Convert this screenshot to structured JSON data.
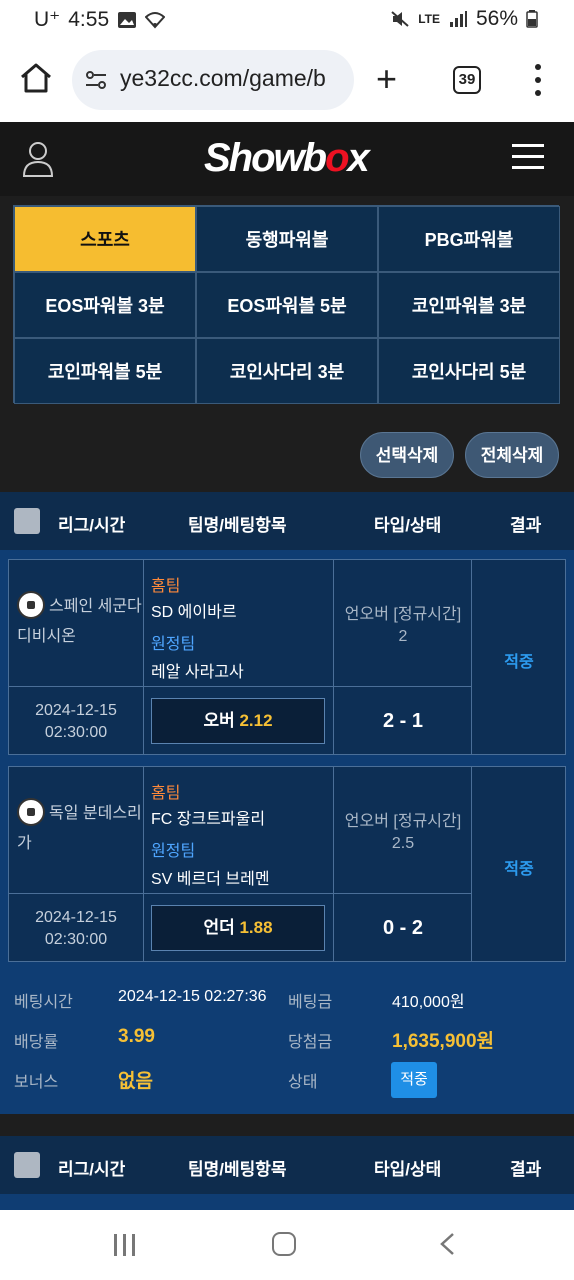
{
  "status": {
    "carrier": "U⁺",
    "time": "4:55",
    "net": "LTE",
    "battery": "56%"
  },
  "browser": {
    "url": "ye32cc.com/game/b",
    "tab_count": "39"
  },
  "site": {
    "logo_pre": "Showb",
    "logo_o": "o",
    "logo_post": "x"
  },
  "games": [
    "스포츠",
    "동행파워볼",
    "PBG파워볼",
    "EOS파워볼 3분",
    "EOS파워볼 5분",
    "코인파워볼 3분",
    "코인파워볼 5분",
    "코인사다리 3분",
    "코인사다리 5분"
  ],
  "actions": {
    "delete_selected": "선택삭제",
    "delete_all": "전체삭제"
  },
  "table_headers": {
    "league_time": "리그/시간",
    "team_item": "팀명/베팅항목",
    "type_status": "타입/상태",
    "result": "결과"
  },
  "bet1": {
    "matches": [
      {
        "league": "스페인 세군다 디비시온",
        "home_label": "홈팀",
        "home": "SD 에이바르",
        "away_label": "원정팀",
        "away": "레알 사라고사",
        "bet_type": "언오버 [정규시간]",
        "line": "2",
        "result": "적중",
        "date": "2024-12-15",
        "time": "02:30:00",
        "pick": "오버",
        "odds": "2.12",
        "score": "2 - 1"
      },
      {
        "league": "독일 분데스리가",
        "home_label": "홈팀",
        "home": "FC 장크트파울리",
        "away_label": "원정팀",
        "away": "SV 베르더 브레멘",
        "bet_type": "언오버 [정규시간]",
        "line": "2.5",
        "result": "적중",
        "date": "2024-12-15",
        "time": "02:30:00",
        "pick": "언더",
        "odds": "1.88",
        "score": "0 - 2"
      }
    ],
    "summary": {
      "bet_time_label": "베팅시간",
      "bet_time": "2024-12-15 02:27:36",
      "bet_amount_label": "베팅금",
      "bet_amount": "410,000원",
      "odds_label": "배당률",
      "odds": "3.99",
      "win_amount_label": "당첨금",
      "win_amount": "1,635,900원",
      "bonus_label": "보너스",
      "bonus": "없음",
      "status_label": "상태",
      "status": "적중"
    }
  }
}
